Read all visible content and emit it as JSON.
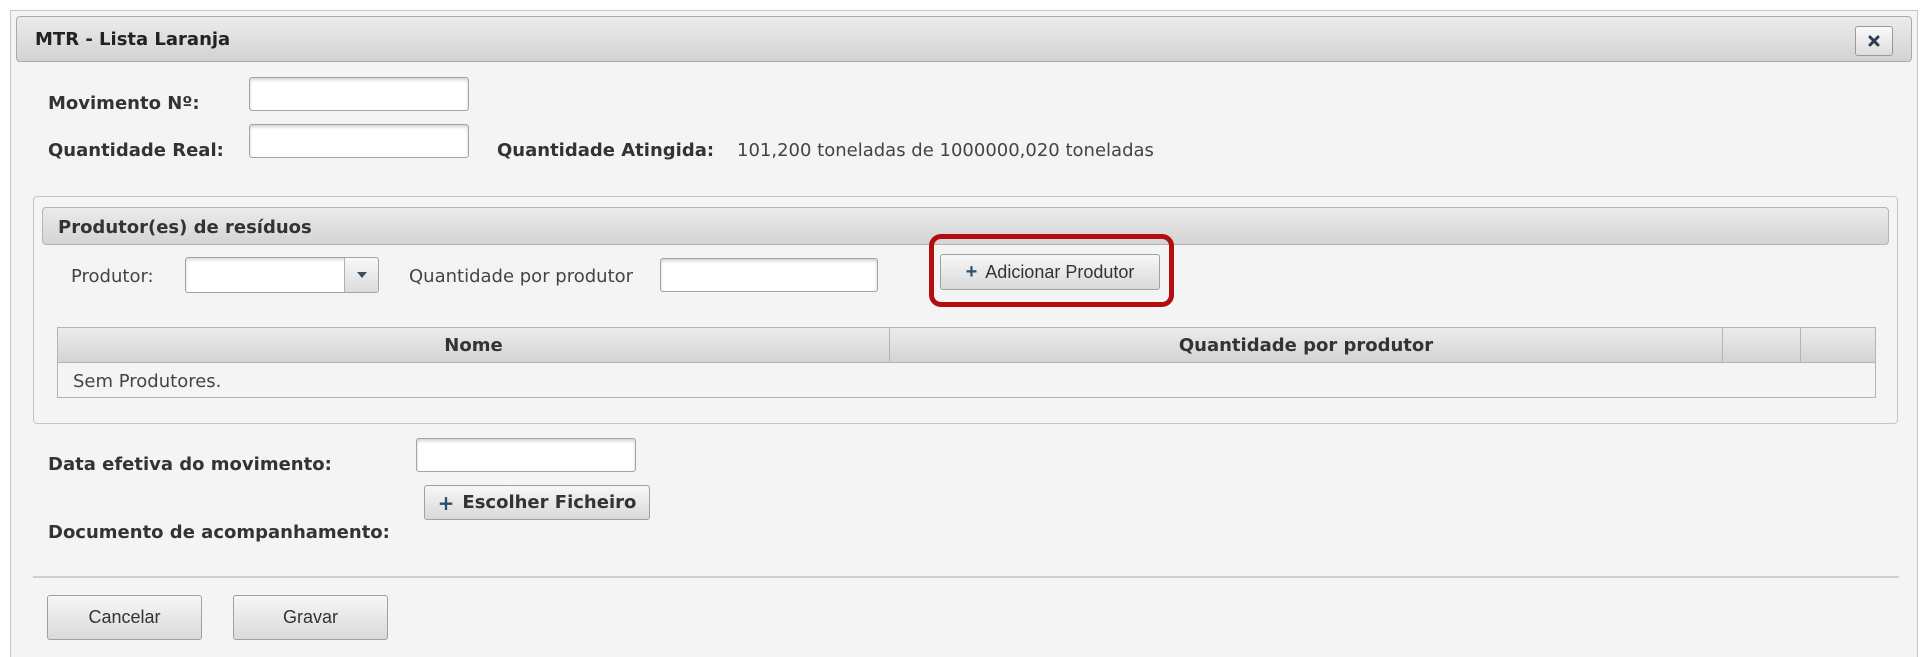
{
  "dialog": {
    "title": "MTR - Lista Laranja",
    "close_icon": "close-icon"
  },
  "form": {
    "movimento_label": "Movimento Nº:",
    "movimento_value": "",
    "quantidade_real_label": "Quantidade Real:",
    "quantidade_real_value": "",
    "quantidade_atingida_label": "Quantidade Atingida:",
    "quantidade_atingida_value": "101,200 toneladas de 1000000,020 toneladas",
    "data_efetiva_label": "Data efetiva do movimento:",
    "data_efetiva_value": "",
    "documento_label": "Documento de acompanhamento:",
    "escolher_ficheiro_label": "Escolher Ficheiro"
  },
  "produtores": {
    "legend": "Produtor(es) de resíduos",
    "produtor_label": "Produtor:",
    "produtor_selected": "",
    "quantidade_label": "Quantidade por produtor",
    "quantidade_value": "",
    "adicionar_label": "Adicionar Produtor",
    "table": {
      "columns": [
        "Nome",
        "Quantidade por produtor",
        "",
        ""
      ],
      "empty_message": "Sem Produtores."
    }
  },
  "footer": {
    "cancelar_label": "Cancelar",
    "gravar_label": "Gravar"
  },
  "colors": {
    "highlight": "#b30d0d",
    "icon_blue": "#2e4f6b"
  }
}
